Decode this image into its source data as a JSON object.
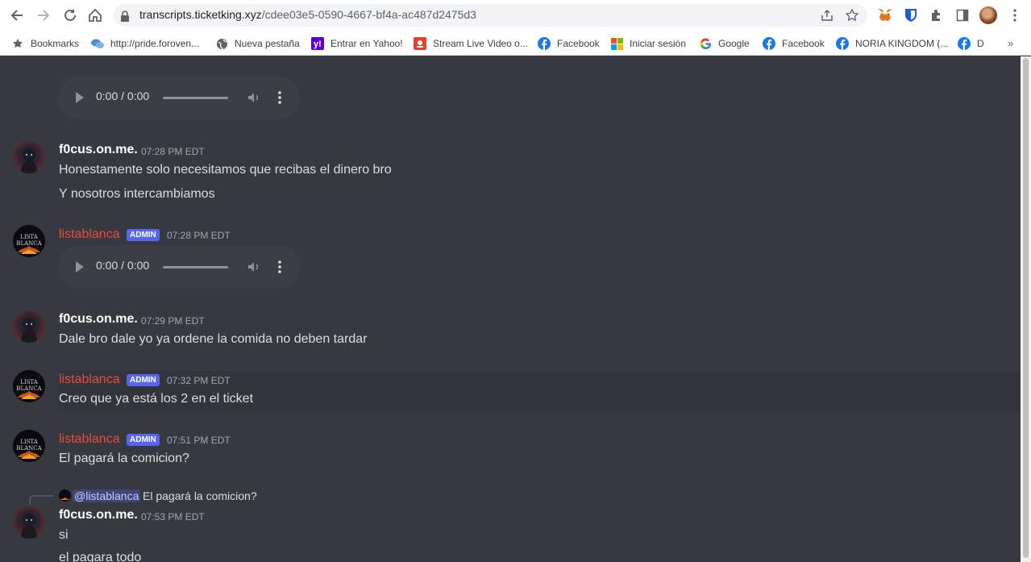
{
  "browser": {
    "url_host": "transcripts.ticketking.xyz",
    "url_path": "/cdee03e5-0590-4667-bf4a-ac487d2475d3"
  },
  "bookmarks": [
    {
      "label": "Bookmarks",
      "icon": "star-icon"
    },
    {
      "label": "http://pride.foroven...",
      "icon": "chat-bubbles-icon"
    },
    {
      "label": "Nueva pestaña",
      "icon": "globe-icon"
    },
    {
      "label": "Entrar en Yahoo!",
      "icon": "yahoo-icon"
    },
    {
      "label": "Stream Live Video o...",
      "icon": "stream-icon"
    },
    {
      "label": "Facebook",
      "icon": "facebook-icon"
    },
    {
      "label": "Iniciar sesión",
      "icon": "microsoft-icon"
    },
    {
      "label": "Google",
      "icon": "google-icon"
    },
    {
      "label": "Facebook",
      "icon": "facebook-icon"
    },
    {
      "label": "NORIA KINGDOM (...",
      "icon": "facebook-icon"
    },
    {
      "label": "D",
      "icon": "facebook-icon"
    }
  ],
  "bookmarks_more": "»",
  "audio": {
    "time": "0:00 / 0:00"
  },
  "messages": {
    "m1": {
      "user": "f0cus.on.me.",
      "time": "07:28 PM EDT",
      "lines": [
        "Honestamente solo necesitamos que recibas el dinero bro",
        "Y nosotros intercambiamos"
      ]
    },
    "m2": {
      "user": "listablanca",
      "badge": "ADMIN",
      "time": "07:28 PM EDT"
    },
    "m3": {
      "user": "f0cus.on.me.",
      "time": "07:29 PM EDT",
      "lines": [
        "Dale bro dale yo ya ordene la comida no deben tardar"
      ]
    },
    "m4": {
      "user": "listablanca",
      "badge": "ADMIN",
      "time": "07:32 PM EDT",
      "lines": [
        "Creo que ya está los 2 en el ticket"
      ]
    },
    "m5": {
      "user": "listablanca",
      "badge": "ADMIN",
      "time": "07:51 PM EDT",
      "lines": [
        "El pagará la comicion?"
      ]
    },
    "m6": {
      "reply": {
        "mention": "@listablanca",
        "text": "El pagará la comicion?"
      },
      "user": "f0cus.on.me.",
      "time": "07:53 PM EDT",
      "lines": [
        "si",
        "el pagara todo"
      ]
    }
  },
  "colors": {
    "admin_badge": "#5865f2",
    "admin_name": "#e74c3c",
    "background": "#36393f"
  }
}
